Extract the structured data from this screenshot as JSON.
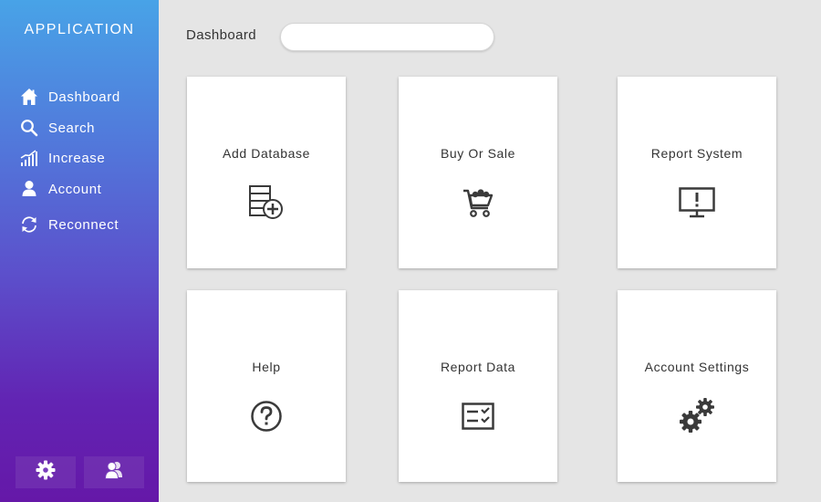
{
  "app": {
    "title": "APPLICATION"
  },
  "sidebar": {
    "items": [
      {
        "label": "Dashboard",
        "icon": "home-icon"
      },
      {
        "label": "Search",
        "icon": "search-icon"
      },
      {
        "label": "Increase",
        "icon": "bar-chart-icon"
      },
      {
        "label": "Account",
        "icon": "user-icon"
      },
      {
        "label": "Reconnect",
        "icon": "refresh-icon"
      }
    ],
    "bottom_buttons": [
      {
        "icon": "gear-icon"
      },
      {
        "icon": "users-icon"
      }
    ]
  },
  "header": {
    "title": "Dashboard",
    "search": {
      "value": "",
      "placeholder": ""
    }
  },
  "cards": [
    {
      "label": "Add Database",
      "icon": "add-database-icon"
    },
    {
      "label": "Buy Or Sale",
      "icon": "shopping-cart-icon"
    },
    {
      "label": "Report System",
      "icon": "monitor-alert-icon"
    },
    {
      "label": "Help",
      "icon": "help-icon"
    },
    {
      "label": "Report Data",
      "icon": "report-data-icon"
    },
    {
      "label": "Account Settings",
      "icon": "gears-icon"
    }
  ],
  "colors": {
    "sidebar_top": "#48a3e7",
    "sidebar_bottom": "#6518a8",
    "background": "#e5e5e5",
    "card": "#ffffff",
    "icon": "#3a3a3a"
  }
}
